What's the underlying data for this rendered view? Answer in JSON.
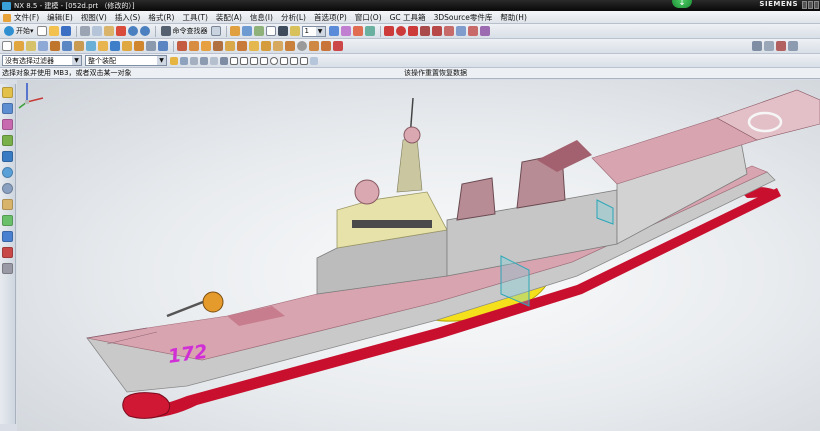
{
  "window": {
    "title": "NX 8.5 - 建模 - [052d.prt （修改的）]",
    "brand": "SIEMENS"
  },
  "menu": [
    "文件(F)",
    "编辑(E)",
    "视图(V)",
    "插入(S)",
    "格式(R)",
    "工具(T)",
    "装配(A)",
    "信息(I)",
    "分析(L)",
    "首选项(P)",
    "窗口(O)",
    "GC 工具箱",
    "3DSource零件库",
    "帮助(H)"
  ],
  "toolbar": {
    "start_label": "开始",
    "command_finder_label": "命令查找器",
    "layer_value": "1"
  },
  "selection": {
    "filter_value": "没有选择过滤器",
    "scope_value": "整个装配"
  },
  "cue": {
    "prompt": "选择对象并使用 MB3，或者双击某一对象",
    "status": "该操作重置恢复数据"
  },
  "model": {
    "hull_number": "172"
  },
  "icons": {
    "toolbar1": [
      "new-icon",
      "open-icon",
      "save-icon",
      "cut-icon",
      "copy-icon",
      "paste-icon",
      "delete-icon",
      "undo-icon",
      "redo-icon"
    ],
    "resource_bar": [
      "assembly-navigator-icon",
      "constraint-navigator-icon",
      "part-navigator-icon",
      "reuse-library-icon",
      "hd3d-icon",
      "web-browser-icon",
      "history-icon",
      "system-materials-icon",
      "process-studio-icon",
      "roles-icon",
      "system-scene-icon"
    ]
  },
  "colors": {
    "hull_red": "#c8102e",
    "hull_grey": "#c9c9c9",
    "deck_pink": "#d8a4b0",
    "superstructure_tan": "#e6e2a9",
    "hull_number": "#d12fd6",
    "sonar_yellow": "#f5e01c"
  }
}
